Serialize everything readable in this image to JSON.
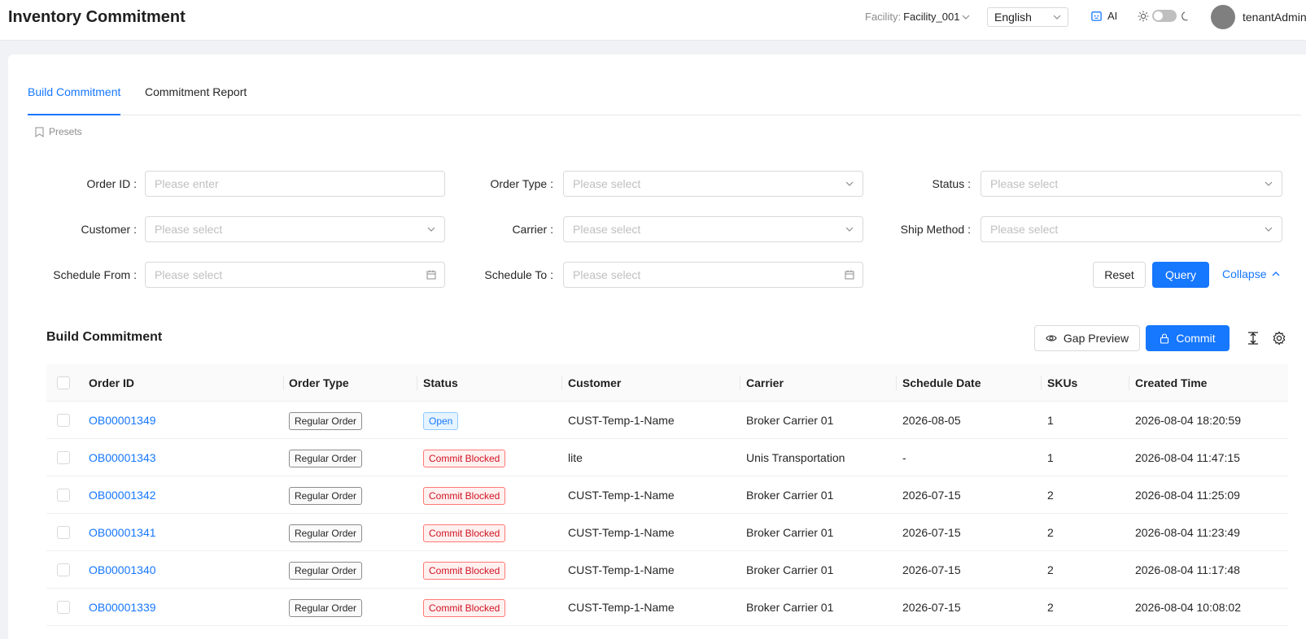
{
  "header": {
    "title": "Inventory Commitment",
    "facility_label": "Facility:",
    "facility_value": "Facility_001",
    "language": "English",
    "ai_label": "AI",
    "username": "tenantAdmin"
  },
  "tabs": [
    {
      "label": "Build Commitment",
      "active": true
    },
    {
      "label": "Commitment Report",
      "active": false
    }
  ],
  "presets_label": "Presets",
  "filters": {
    "order_id": {
      "label": "Order ID",
      "placeholder": "Please enter"
    },
    "order_type": {
      "label": "Order Type",
      "placeholder": "Please select"
    },
    "status": {
      "label": "Status",
      "placeholder": "Please select"
    },
    "customer": {
      "label": "Customer",
      "placeholder": "Please select"
    },
    "carrier": {
      "label": "Carrier",
      "placeholder": "Please select"
    },
    "ship_method": {
      "label": "Ship Method",
      "placeholder": "Please select"
    },
    "schedule_from": {
      "label": "Schedule From",
      "placeholder": "Please select"
    },
    "schedule_to": {
      "label": "Schedule To",
      "placeholder": "Please select"
    }
  },
  "filter_actions": {
    "reset": "Reset",
    "query": "Query",
    "collapse": "Collapse"
  },
  "section": {
    "title": "Build Commitment",
    "gap_preview": "Gap Preview",
    "commit": "Commit"
  },
  "table": {
    "columns": [
      "Order ID",
      "Order Type",
      "Status",
      "Customer",
      "Carrier",
      "Schedule Date",
      "SKUs",
      "Created Time"
    ],
    "rows": [
      {
        "order_id": "OB00001349",
        "order_type": "Regular Order",
        "status": "Open",
        "customer": "CUST-Temp-1-Name",
        "carrier": "Broker Carrier 01",
        "schedule_date": "2026-08-05",
        "skus": "1",
        "created": "2026-08-04 18:20:59"
      },
      {
        "order_id": "OB00001343",
        "order_type": "Regular Order",
        "status": "Commit Blocked",
        "customer": "lite",
        "carrier": "Unis Transportation",
        "schedule_date": "-",
        "skus": "1",
        "created": "2026-08-04 11:47:15"
      },
      {
        "order_id": "OB00001342",
        "order_type": "Regular Order",
        "status": "Commit Blocked",
        "customer": "CUST-Temp-1-Name",
        "carrier": "Broker Carrier 01",
        "schedule_date": "2026-07-15",
        "skus": "2",
        "created": "2026-08-04 11:25:09"
      },
      {
        "order_id": "OB00001341",
        "order_type": "Regular Order",
        "status": "Commit Blocked",
        "customer": "CUST-Temp-1-Name",
        "carrier": "Broker Carrier 01",
        "schedule_date": "2026-07-15",
        "skus": "2",
        "created": "2026-08-04 11:23:49"
      },
      {
        "order_id": "OB00001340",
        "order_type": "Regular Order",
        "status": "Commit Blocked",
        "customer": "CUST-Temp-1-Name",
        "carrier": "Broker Carrier 01",
        "schedule_date": "2026-07-15",
        "skus": "2",
        "created": "2026-08-04 11:17:48"
      },
      {
        "order_id": "OB00001339",
        "order_type": "Regular Order",
        "status": "Commit Blocked",
        "customer": "CUST-Temp-1-Name",
        "carrier": "Broker Carrier 01",
        "schedule_date": "2026-07-15",
        "skus": "2",
        "created": "2026-08-04 10:08:02"
      }
    ]
  },
  "colors": {
    "primary": "#1677ff",
    "open": "#1677ff",
    "blocked": "#cf1322"
  }
}
